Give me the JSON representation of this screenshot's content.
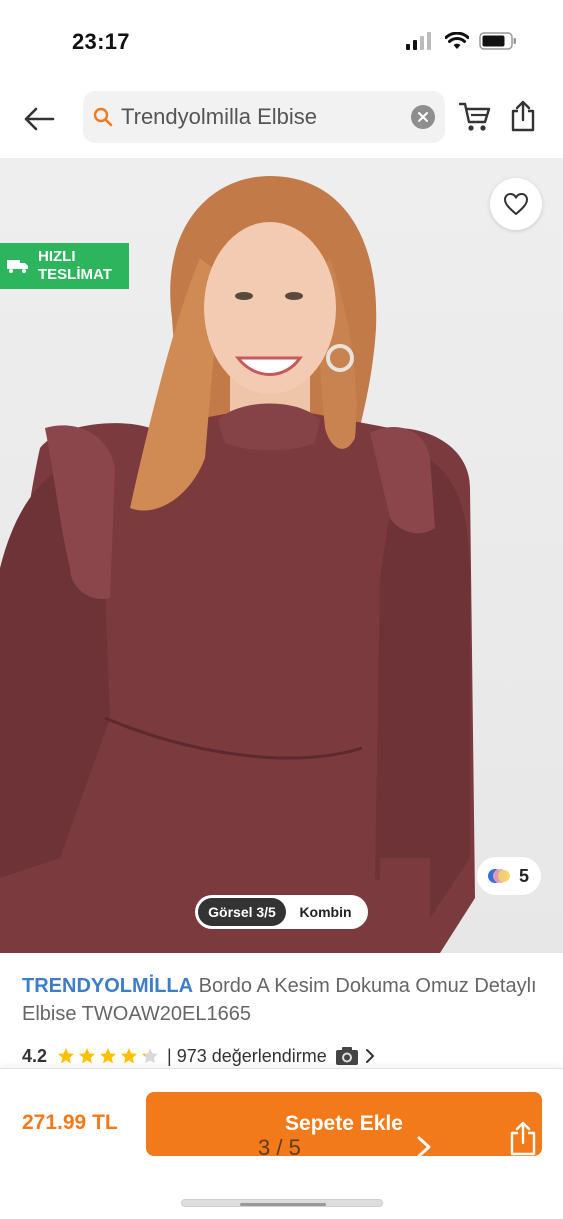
{
  "status_bar": {
    "time": "23:17"
  },
  "header": {
    "search": {
      "value": "Trendyolmilla Elbise"
    },
    "icons": {
      "back": "arrow-left-icon",
      "search": "search-icon",
      "clear": "clear-icon",
      "cart": "cart-icon",
      "share": "share-icon"
    }
  },
  "gallery": {
    "fast_delivery_line1": "HIZLI",
    "fast_delivery_line2": "TESLİMAT",
    "color_count": "5",
    "tab_active": "Görsel 3/5",
    "tab_other": "Kombin"
  },
  "product": {
    "brand": "TRENDYOLMİLLA",
    "name": "Bordo A Kesim Dokuma Omuz Detaylı Elbise TWOAW20EL1665",
    "rating": "4.2",
    "review_count": "| 973 değerlendirme",
    "stars_filled": 4.2
  },
  "bottom_bar": {
    "price": "271.99 TL",
    "add_to_cart": "Sepete Ekle",
    "pager": "3 / 5"
  },
  "colors": {
    "brand_orange": "#f27a1a",
    "brand_blue": "#3d7ec7",
    "fast_green": "#2db55d"
  }
}
